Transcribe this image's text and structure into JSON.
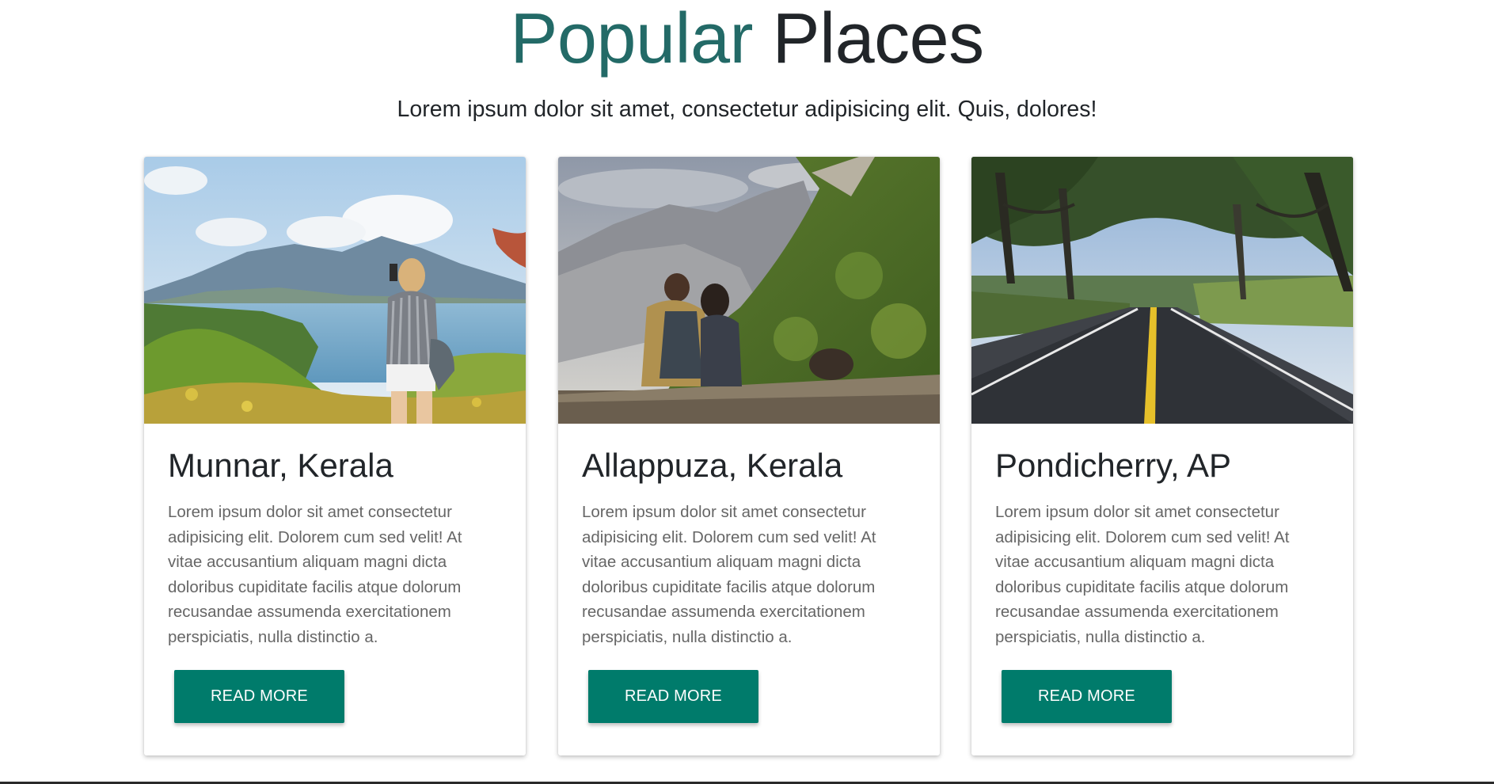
{
  "header": {
    "title_accent": "Popular",
    "title_rest": "Places",
    "subtitle": "Lorem ipsum dolor sit amet, consectetur adipisicing elit. Quis, dolores!"
  },
  "colors": {
    "accent": "#236a67",
    "button": "#007b6b"
  },
  "cards": [
    {
      "title": "Munnar, Kerala",
      "text": "Lorem ipsum dolor sit amet consectetur adipisicing elit. Dolorem cum sed velit! At vitae accusantium aliquam magni dicta doloribus cupiditate facilis atque dolorum recusandae assumenda exercitationem perspiciatis, nulla distinctio a.",
      "button": "READ MORE"
    },
    {
      "title": "Allappuza, Kerala",
      "text": "Lorem ipsum dolor sit amet consectetur adipisicing elit. Dolorem cum sed velit! At vitae accusantium aliquam magni dicta doloribus cupiditate facilis atque dolorum recusandae assumenda exercitationem perspiciatis, nulla distinctio a.",
      "button": "READ MORE"
    },
    {
      "title": "Pondicherry, AP",
      "text": "Lorem ipsum dolor sit amet consectetur adipisicing elit. Dolorem cum sed velit! At vitae accusantium aliquam magni dicta doloribus cupiditate facilis atque dolorum recusandae assumenda exercitationem perspiciatis, nulla distinctio a.",
      "button": "READ MORE"
    }
  ]
}
